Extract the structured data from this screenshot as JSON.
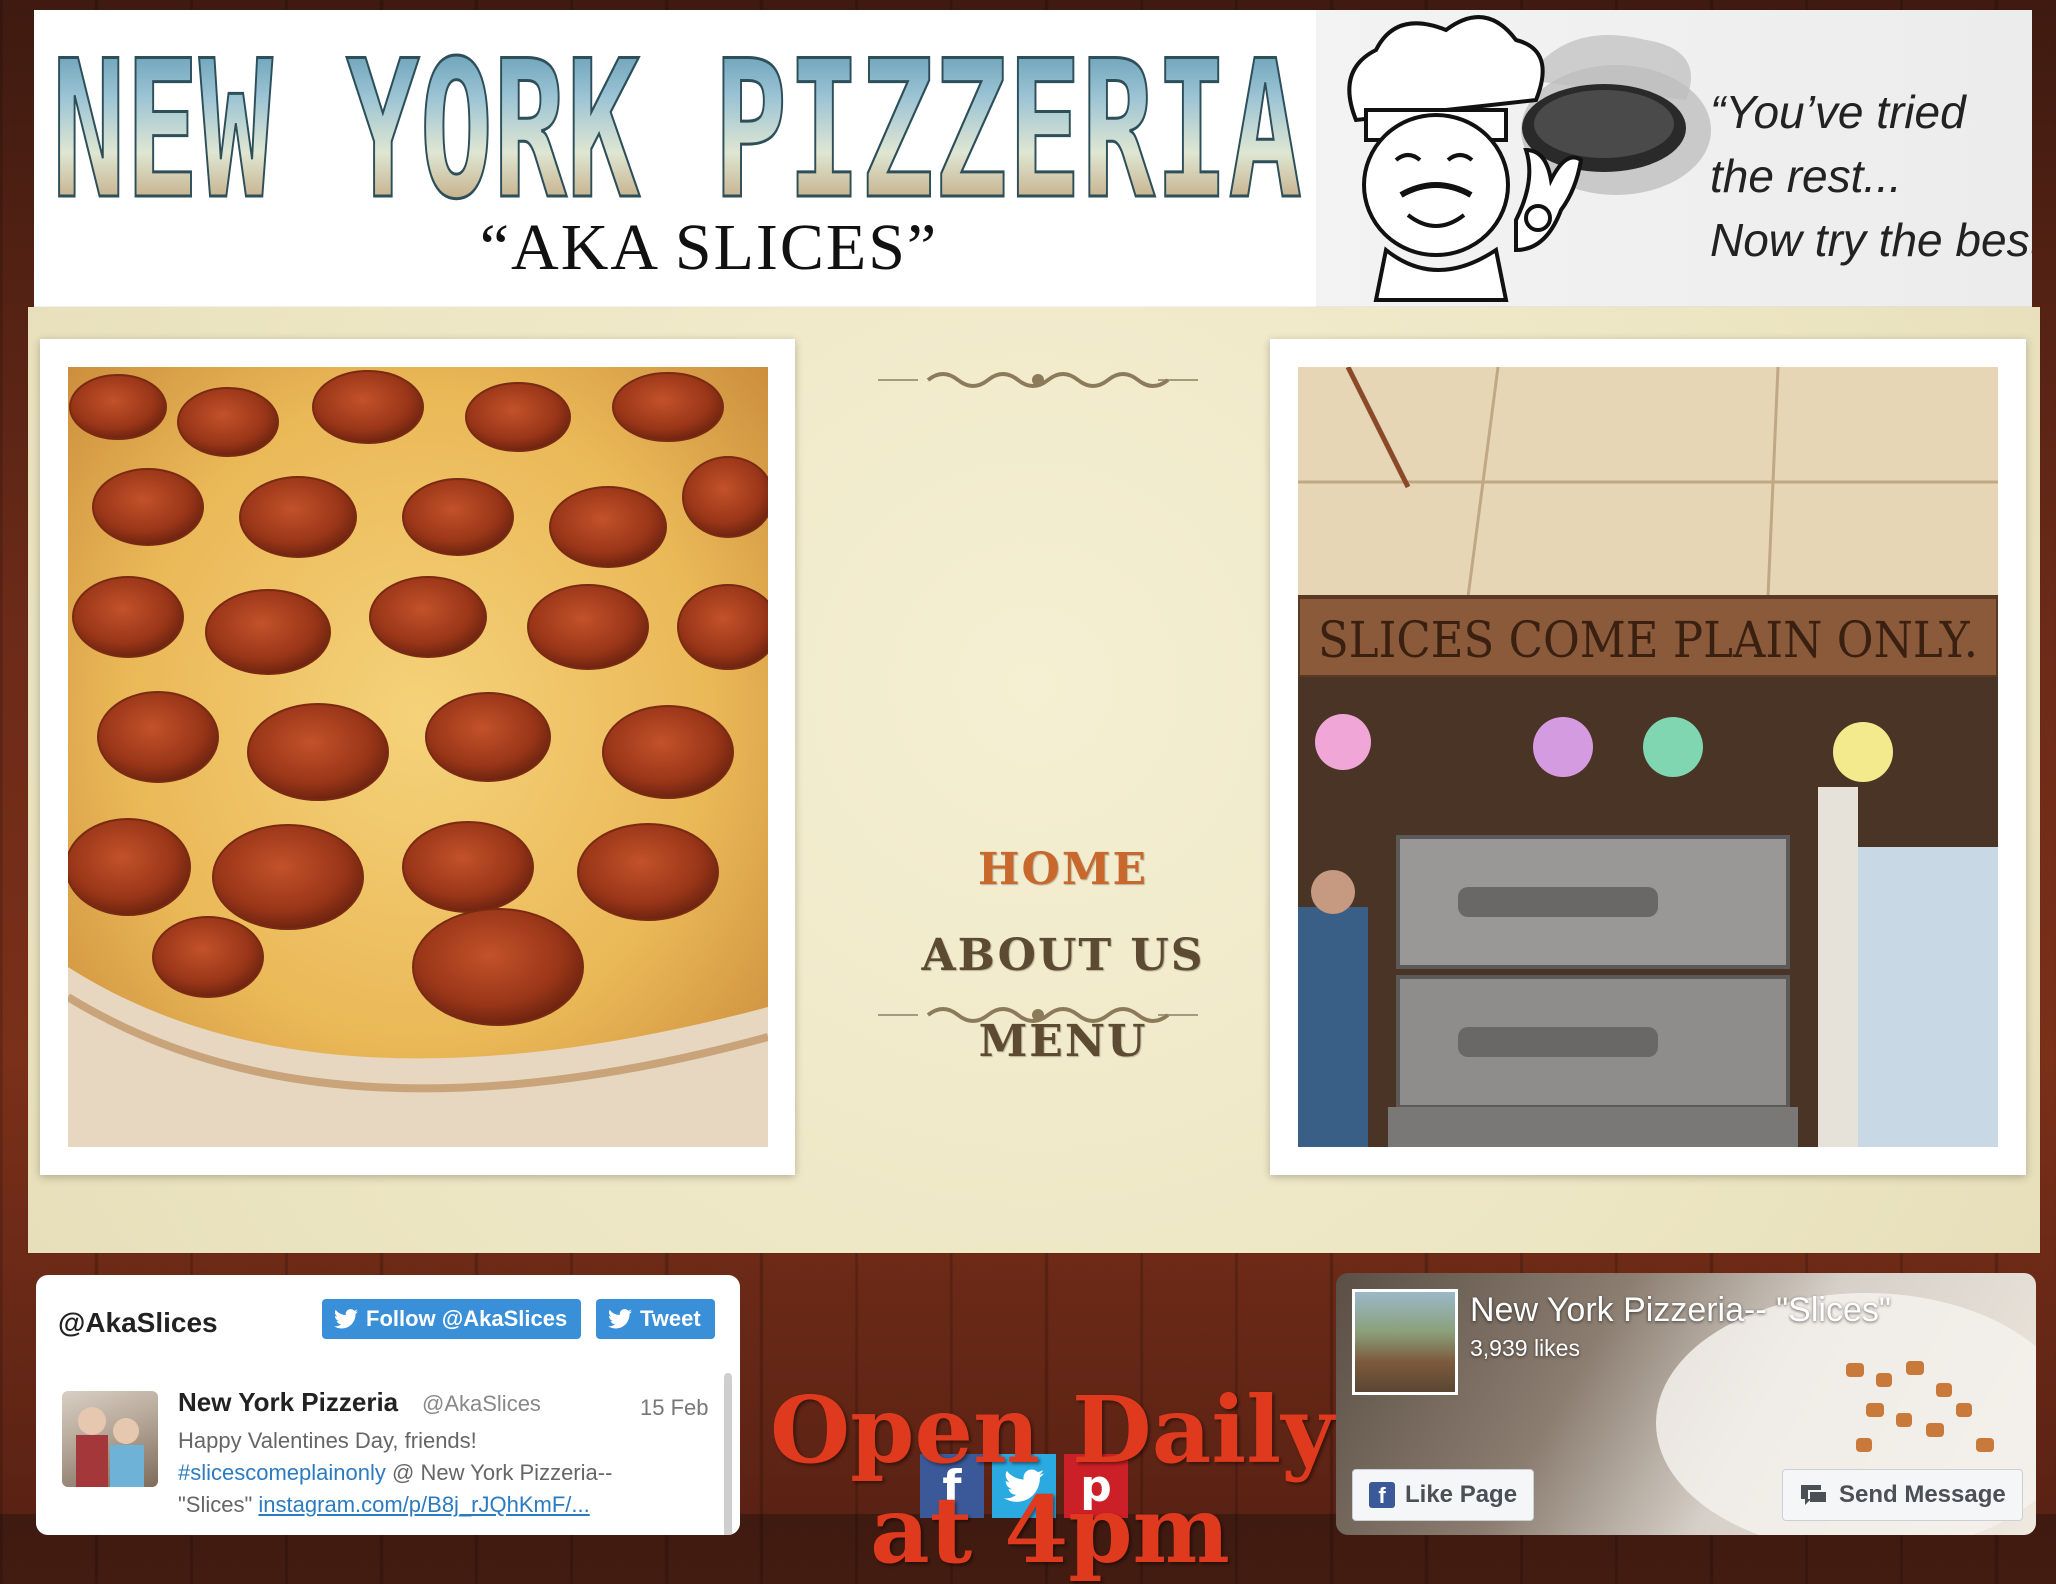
{
  "header": {
    "brand_title": "NEW YORK PIZZERIA",
    "brand_subtitle": "“AKA SLICES”",
    "slogan_lines": [
      "“You’ve tried",
      "the rest...",
      "Now try the best!”"
    ]
  },
  "nav": {
    "items": [
      {
        "label": "HOME",
        "active": true
      },
      {
        "label": "ABOUT US",
        "active": false
      },
      {
        "label": "MENU",
        "active": false
      }
    ]
  },
  "photos": {
    "right_sign_text": "SLICES COME PLAIN ONLY."
  },
  "social": {
    "facebook_icon": "f",
    "twitter_icon": "twitter-bird",
    "pinterest_icon": "p",
    "colors": {
      "facebook": "#3b5998",
      "twitter": "#2ba9e1",
      "pinterest": "#cb2027"
    }
  },
  "twitter_widget": {
    "handle": "@AkaSlices",
    "follow_label": "Follow @AkaSlices",
    "tweet_label": "Tweet",
    "tweet": {
      "author": "New York Pizzeria",
      "author_handle": "@AkaSlices",
      "date": "15 Feb",
      "line1": "Happy Valentines Day, friends!",
      "hashtag": "#slicescomeplainonly",
      "line2_rest": " @ New York Pizzeria--",
      "line3_prefix": "\"Slices\" ",
      "link": "instagram.com/p/B8j_rJQhKmF/..."
    }
  },
  "hours": {
    "line1": "Open Daily",
    "line2": "at 4pm"
  },
  "facebook_widget": {
    "page_name": "New York Pizzeria-- \"Slices\"",
    "likes": "3,939 likes",
    "like_button": "Like Page",
    "message_button": "Send Message"
  }
}
